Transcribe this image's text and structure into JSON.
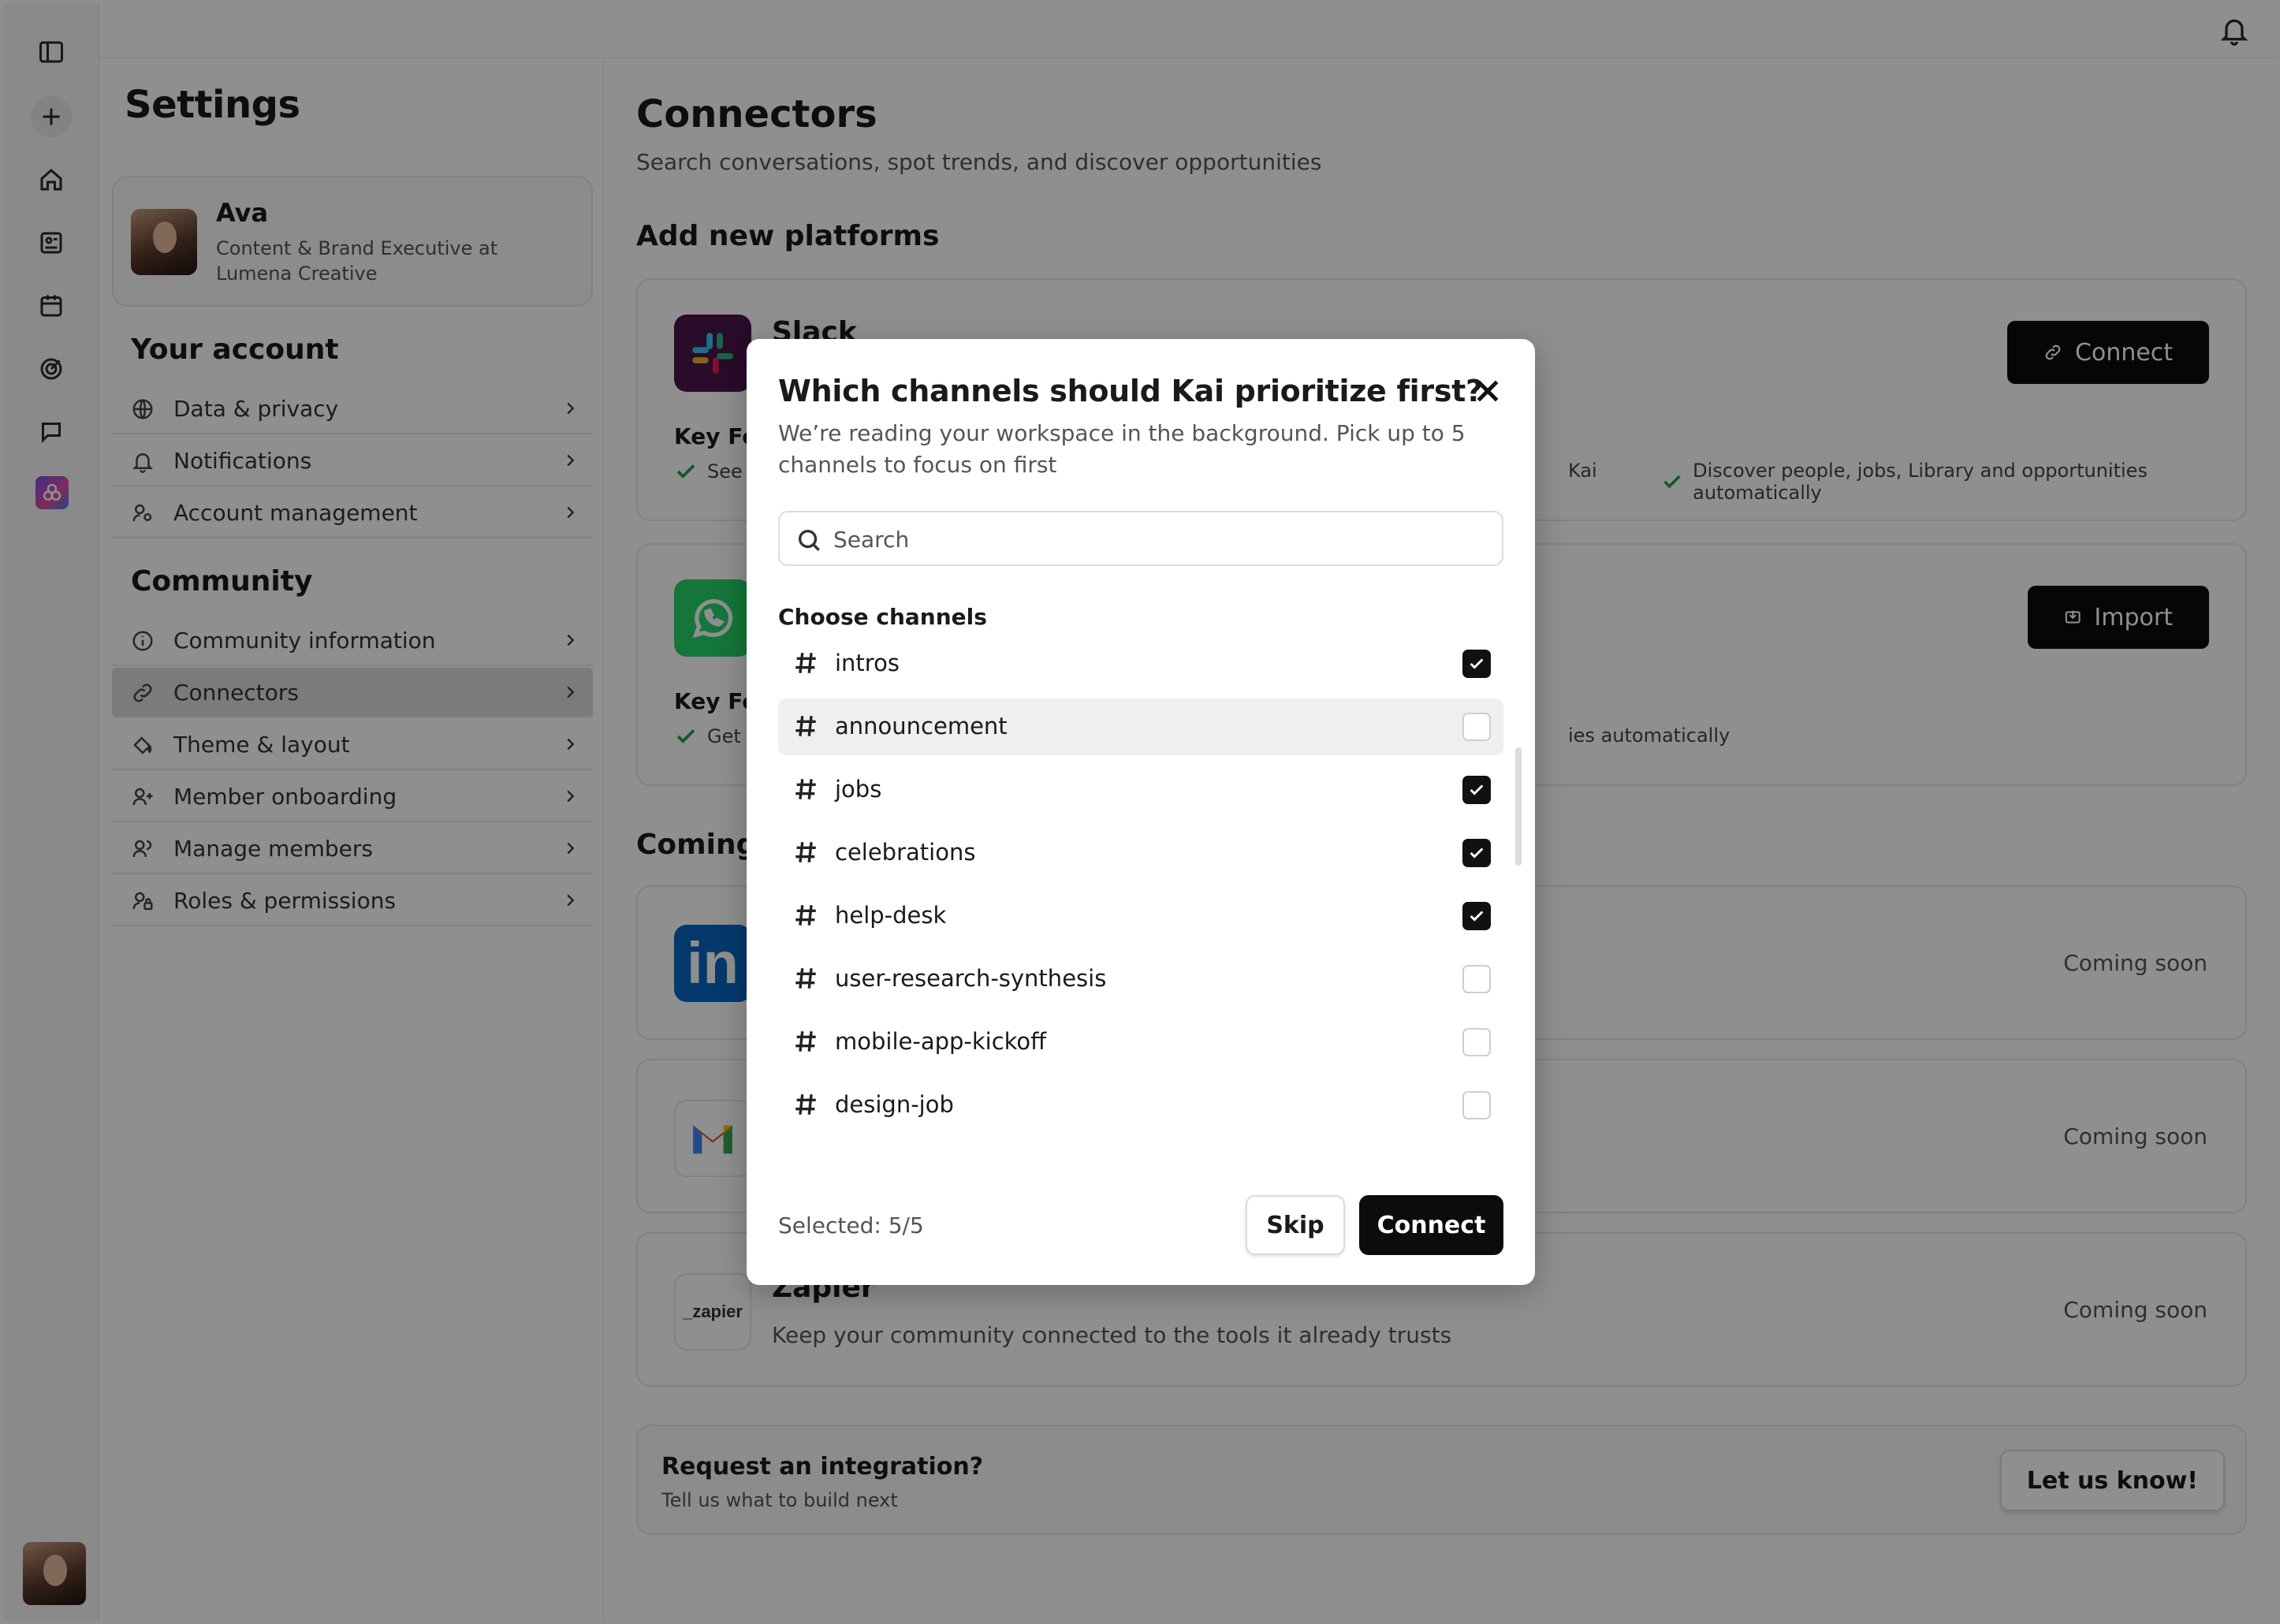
{
  "rail": {
    "icons": [
      "sidebar-toggle-icon",
      "plus-icon",
      "home-icon",
      "profile-card-icon",
      "calendar-icon",
      "target-icon",
      "chat-icon",
      "brand-logo-icon"
    ]
  },
  "settings": {
    "title": "Settings",
    "profile": {
      "name": "Ava",
      "role": "Content & Brand Executive at Lumena Creative"
    },
    "your_account": {
      "heading": "Your account",
      "items": [
        {
          "label": "Data & privacy",
          "icon": "globe-icon"
        },
        {
          "label": "Notifications",
          "icon": "bell-icon"
        },
        {
          "label": "Account management",
          "icon": "user-gear-icon"
        }
      ]
    },
    "community": {
      "heading": "Community",
      "items": [
        {
          "label": "Community information",
          "icon": "info-icon"
        },
        {
          "label": "Connectors",
          "icon": "link-icon",
          "active": true
        },
        {
          "label": "Theme & layout",
          "icon": "paint-bucket-icon"
        },
        {
          "label": "Member onboarding",
          "icon": "user-plus-icon"
        },
        {
          "label": "Manage members",
          "icon": "users-icon"
        },
        {
          "label": "Roles & permissions",
          "icon": "user-lock-icon"
        }
      ]
    }
  },
  "main": {
    "title": "Connectors",
    "subtitle": "Search conversations, spot trends, and discover opportunities",
    "add_new_heading": "Add new platforms",
    "coming_heading": "Coming",
    "slack": {
      "name": "Slack",
      "key_features": "Key Fe",
      "feature_left": "See",
      "feature_mid": "Kai",
      "feature_right": "Discover people, jobs, Library and opportunities automatically",
      "button": "Connect"
    },
    "whatsapp": {
      "key_features": "Key Fe",
      "feature_left": "Get",
      "feature_right": "ies automatically",
      "button": "Import"
    },
    "linkedin": {
      "status": "Coming soon"
    },
    "gmail": {
      "status": "Coming soon"
    },
    "zapier": {
      "name": "Zapier",
      "desc": "Keep your community connected to the tools it already trusts",
      "status": "Coming soon",
      "logo_text": "_zapier"
    },
    "request": {
      "title": "Request an integration?",
      "subtitle": "Tell us what to build next",
      "button": "Let us know!"
    }
  },
  "modal": {
    "title": "Which channels should Kai prioritize first?",
    "description": "We’re reading your workspace in the background. Pick up to 5 channels to focus on first",
    "search_placeholder": "Search",
    "choose_label": "Choose channels",
    "channels": [
      {
        "name": "intros",
        "checked": true
      },
      {
        "name": "announcement",
        "checked": false,
        "hover": true
      },
      {
        "name": "jobs",
        "checked": true
      },
      {
        "name": "celebrations",
        "checked": true
      },
      {
        "name": "help-desk",
        "checked": true
      },
      {
        "name": "user-research-synthesis",
        "checked": false
      },
      {
        "name": "mobile-app-kickoff",
        "checked": false
      },
      {
        "name": "design-job",
        "checked": false
      }
    ],
    "selected_text": "Selected: 5/5",
    "skip_label": "Skip",
    "connect_label": "Connect"
  },
  "colors": {
    "overlay": "#00000070",
    "primary_button": "#0c0c0c",
    "check_green": "#2c9a4a",
    "active_menu": "#dcdcdc"
  }
}
